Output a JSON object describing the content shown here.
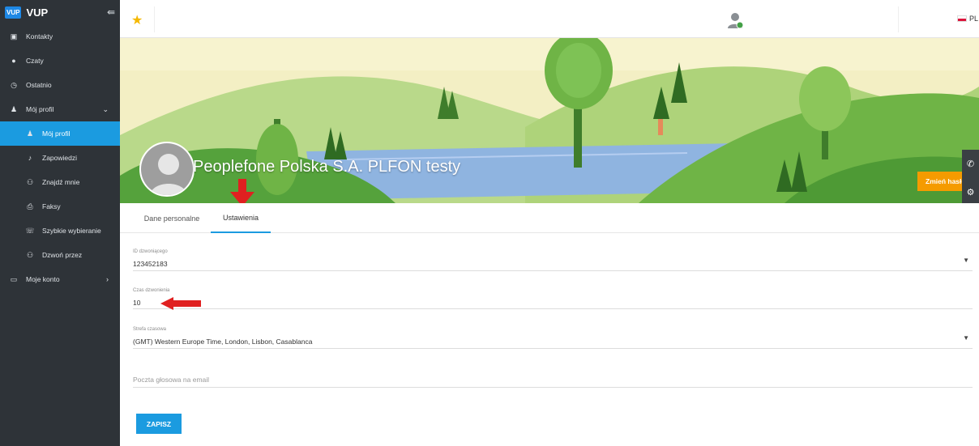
{
  "sidebar": {
    "logo_badge": "VUP",
    "logo_text": "VUP",
    "items": [
      {
        "label": "Kontakty",
        "icon": "contacts-icon"
      },
      {
        "label": "Czaty",
        "icon": "chat-icon"
      },
      {
        "label": "Ostatnio",
        "icon": "clock-icon"
      },
      {
        "label": "Mój profil",
        "icon": "user-icon"
      },
      {
        "label": "Mój profil",
        "icon": "user-icon"
      },
      {
        "label": "Zapowiedzi",
        "icon": "music-note-icon"
      },
      {
        "label": "Znajdź mnie",
        "icon": "users-icon"
      },
      {
        "label": "Faksy",
        "icon": "fax-icon"
      },
      {
        "label": "Szybkie wybieranie",
        "icon": "speed-dial-icon"
      },
      {
        "label": "Dzwoń przez",
        "icon": "call-through-icon"
      },
      {
        "label": "Moje konto",
        "icon": "account-icon"
      }
    ]
  },
  "topbar": {
    "language": "PL"
  },
  "profile": {
    "name": "Peoplefone Polska S.A. PLFON testy",
    "change_password": "Zmień hasło"
  },
  "tabs": [
    {
      "label": "Dane personalne",
      "active": false
    },
    {
      "label": "Ustawienia",
      "active": true
    }
  ],
  "form": {
    "caller_id": {
      "label": "ID dzwoniącego",
      "value": "123452183"
    },
    "ring_time": {
      "label": "Czas dzwonienia",
      "value": "10"
    },
    "timezone": {
      "label": "Strefa czasowa",
      "value": "(GMT) Western Europe Time, London, Lisbon, Casablanca"
    },
    "voicemail_email": {
      "placeholder": "Poczta głosowa na email"
    },
    "save": "ZAPISZ"
  },
  "colors": {
    "sidebar_bg": "#2e3338",
    "accent": "#1b9be0",
    "warning": "#f59b00",
    "annotation": "#e02020"
  }
}
